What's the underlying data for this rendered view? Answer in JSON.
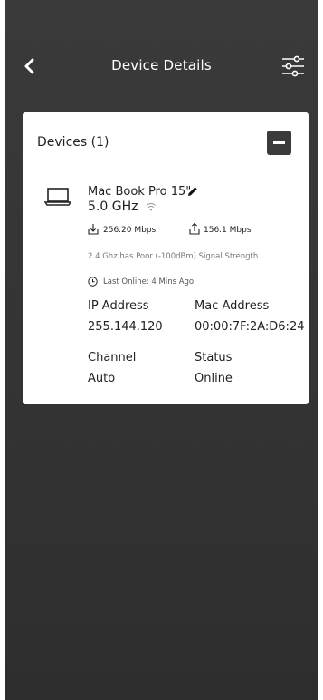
{
  "header": {
    "title": "Device Details",
    "back_icon": "chevron-left-icon",
    "filter_icon": "sliders-icon"
  },
  "card": {
    "title": "Devices (1)",
    "collapse_icon": "minus-icon",
    "device": {
      "icon": "laptop-icon",
      "name": "Mac Book Pro 15\"",
      "band": "5.0 GHz",
      "download_speed": "256.20 Mbps",
      "upload_speed": "156.1 Mbps",
      "signal_text": "2.4 Ghz has Poor (-100dBm) Signal Strength",
      "last_online": "Last Online: 4 Mins Ago",
      "ip_label": "IP Address",
      "ip_value": "255.144.120",
      "mac_label": "Mac Address",
      "mac_value": "00:00:7F:2A:D6:24",
      "channel_label": "Channel",
      "channel_value": "Auto",
      "status_label": "Status",
      "status_value": "Online"
    }
  },
  "colors": {
    "background": "#353535",
    "card": "#ffffff",
    "button": "#3b3b3b"
  }
}
